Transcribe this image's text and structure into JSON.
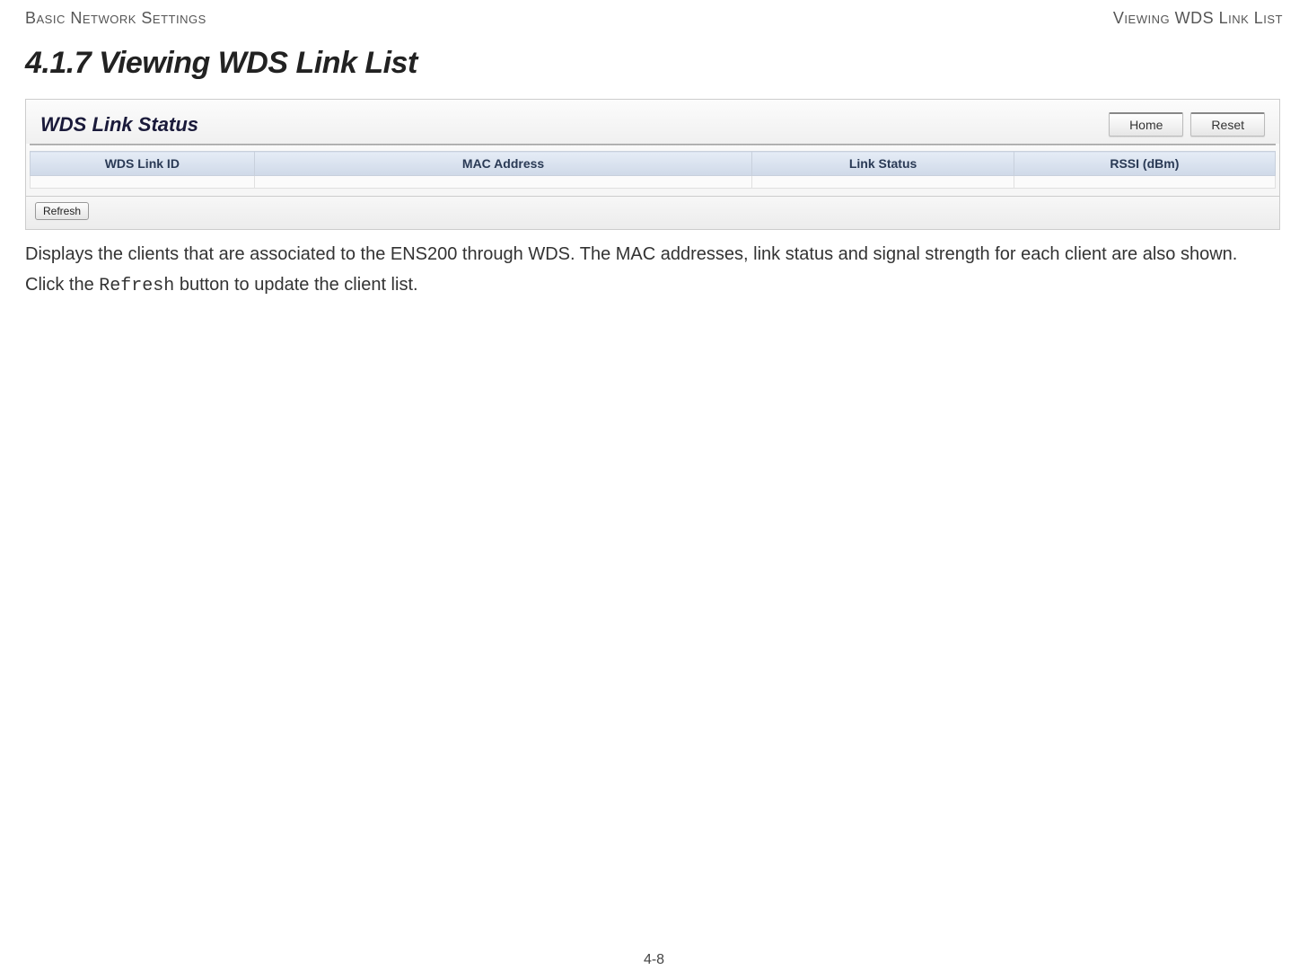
{
  "header": {
    "left": "Basic Network Settings",
    "right": "Viewing WDS Link List"
  },
  "section_title": "4.1.7 Viewing WDS Link List",
  "screenshot": {
    "panel_title": "WDS Link Status",
    "buttons": {
      "home": "Home",
      "reset": "Reset",
      "refresh": "Refresh"
    },
    "columns": {
      "id": "WDS Link ID",
      "mac": "MAC Address",
      "status": "Link Status",
      "rssi": "RSSI (dBm)"
    }
  },
  "paragraph1": "Displays the clients that are associated to the ENS200 through WDS. The MAC addresses, link status and signal strength for each client are also shown.",
  "paragraph2_prefix": "Click the ",
  "paragraph2_code": "Refresh",
  "paragraph2_suffix": " button to update the client list.",
  "page_number": "4-8"
}
